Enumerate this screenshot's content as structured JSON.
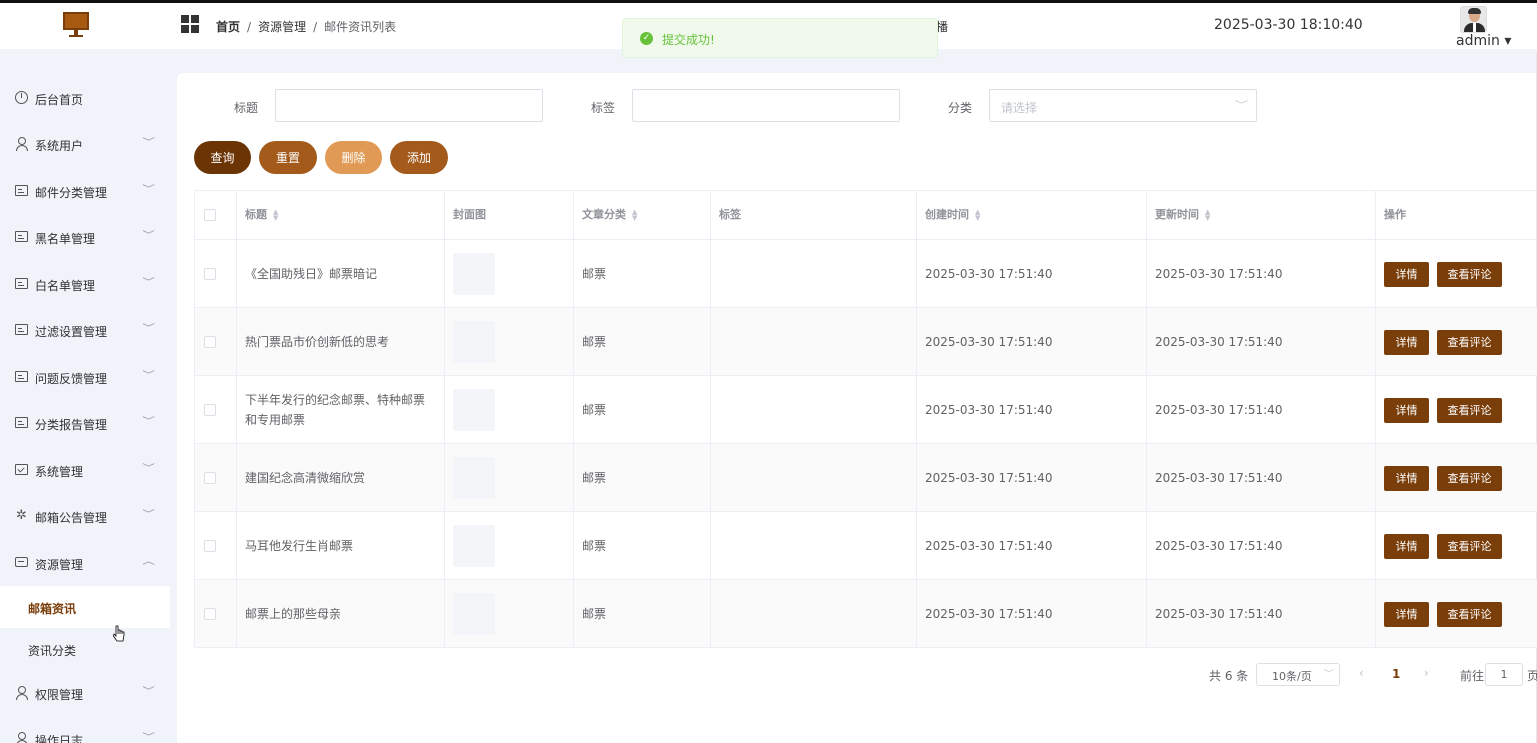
{
  "header": {
    "breadcrumb": [
      "首页",
      "资源管理",
      "邮件资讯列表"
    ],
    "peek_text": "播",
    "datetime": "2025-03-30 18:10:40",
    "user": "admin ▾"
  },
  "toast": {
    "message": "提交成功!"
  },
  "sidebar": {
    "items": [
      {
        "label": "后台首页",
        "icon": "dashboard-icon"
      },
      {
        "label": "系统用户",
        "icon": "user-icon"
      },
      {
        "label": "邮件分类管理",
        "icon": "document-icon"
      },
      {
        "label": "黑名单管理",
        "icon": "document-icon"
      },
      {
        "label": "白名单管理",
        "icon": "document-icon"
      },
      {
        "label": "过滤设置管理",
        "icon": "document-icon"
      },
      {
        "label": "问题反馈管理",
        "icon": "document-icon"
      },
      {
        "label": "分类报告管理",
        "icon": "document-icon"
      },
      {
        "label": "系统管理",
        "icon": "folder-icon"
      },
      {
        "label": "邮箱公告管理",
        "icon": "sun-icon"
      },
      {
        "label": "资源管理",
        "icon": "box-icon"
      }
    ],
    "sub_items": [
      "邮箱资讯",
      "资讯分类"
    ],
    "bottom_items": [
      {
        "label": "权限管理",
        "icon": "user-icon"
      },
      {
        "label": "操作日志",
        "icon": "user-icon"
      }
    ]
  },
  "filters": {
    "title_label": "标题",
    "tag_label": "标签",
    "category_label": "分类",
    "category_placeholder": "请选择"
  },
  "buttons": {
    "query": "查询",
    "reset": "重置",
    "delete": "删除",
    "add": "添加"
  },
  "colors": {
    "primary": "#7a3e0a",
    "query": "#6b3404",
    "reset": "#a35a1b",
    "delete": "#e09a55",
    "add": "#a35a1b",
    "success": "#67c23a"
  },
  "table": {
    "headers": [
      "标题",
      "封面图",
      "文章分类",
      "标签",
      "创建时间",
      "更新时间",
      "操作"
    ],
    "rows": [
      {
        "title": "《全国助残日》邮票暗记",
        "category": "邮票",
        "tag": "",
        "created": "2025-03-30 17:51:40",
        "updated": "2025-03-30 17:51:40"
      },
      {
        "title": "热门票品市价创新低的思考",
        "category": "邮票",
        "tag": "",
        "created": "2025-03-30 17:51:40",
        "updated": "2025-03-30 17:51:40"
      },
      {
        "title": "下半年发行的纪念邮票、特种邮票和专用邮票",
        "category": "邮票",
        "tag": "",
        "created": "2025-03-30 17:51:40",
        "updated": "2025-03-30 17:51:40"
      },
      {
        "title": "建国纪念高清微缩欣赏",
        "category": "邮票",
        "tag": "",
        "created": "2025-03-30 17:51:40",
        "updated": "2025-03-30 17:51:40"
      },
      {
        "title": "马耳他发行生肖邮票",
        "category": "邮票",
        "tag": "",
        "created": "2025-03-30 17:51:40",
        "updated": "2025-03-30 17:51:40"
      },
      {
        "title": "邮票上的那些母亲",
        "category": "邮票",
        "tag": "",
        "created": "2025-03-30 17:51:40",
        "updated": "2025-03-30 17:51:40"
      }
    ],
    "action_detail": "详情",
    "action_comments": "查看评论"
  },
  "pagination": {
    "total": "共 6 条",
    "page_size": "10条/页",
    "current_page": "1",
    "goto_label": "前往",
    "goto_value": "1",
    "page_unit": "页"
  }
}
